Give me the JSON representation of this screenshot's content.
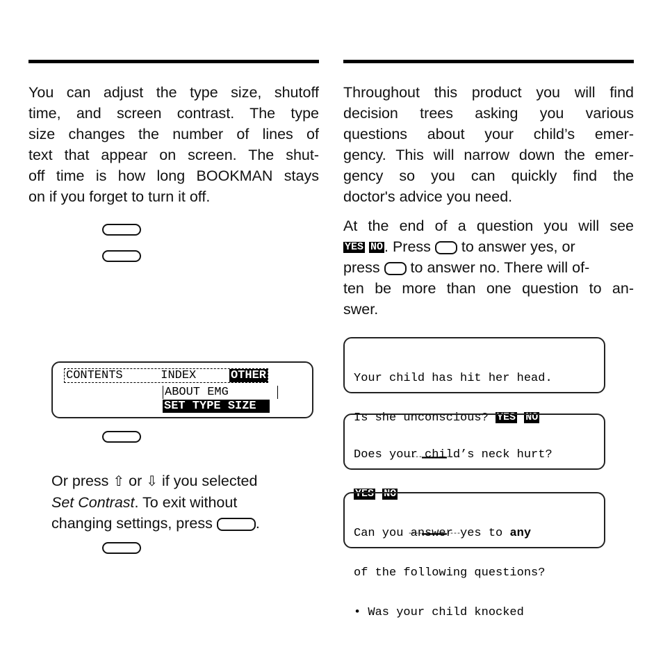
{
  "left": {
    "intro_lines": [
      "You can adjust the type size, shutoff",
      "time, and screen contrast. The type",
      "size changes the number of lines of",
      "text that appear on screen. The shut-",
      "off time is how long BOOKMAN stays",
      "on if you forget to turn it off."
    ],
    "menu_screen": {
      "menu_items": [
        "CONTENTS",
        "INDEX",
        "OTHER"
      ],
      "submenu_items": [
        "ABOUT EMG",
        "SET TYPE SIZE"
      ]
    },
    "or_press": "Or press",
    "or": "or",
    "if_selected": "if you selected",
    "set_contrast": "Set Contrast",
    "exit_text": ". To exit without",
    "changing_text": "changing settings, press",
    "period": ".",
    "up_arrow": "⇧",
    "down_arrow": "⇩"
  },
  "right": {
    "intro_lines": [
      "Throughout this product you will find",
      "decision trees asking you various",
      "questions about your child’s emer-",
      "gency. This will narrow down the emer-",
      "gency so you can quickly find the",
      "doctor's advice you need."
    ],
    "para2_line1": "At the end of a question you will see",
    "yes_tag": "YES",
    "no_tag": "NO",
    "press_text": ". Press",
    "answer_yes": "to answer yes, or",
    "press2": "press",
    "answer_no": "to answer no. There will of-",
    "para2_line4": "ten be more than one question to an-",
    "para2_line5": "swer.",
    "screens": [
      {
        "line1": "Your child has hit her head.",
        "line2": "Is she unconscious?",
        "yes": "YES",
        "no": "NO",
        "scroll": "----▬▬▬▬▬▬▬----"
      },
      {
        "line1": "Does your child’s neck hurt?",
        "yes": "YES",
        "no": "NO",
        "scroll": "----▬▬▬▬▬▬▬----"
      },
      {
        "line1": "Can you answer yes to",
        "line1_bold": "any",
        "line2": "of the following questions?",
        "line3": "• Was your child knocked"
      }
    ]
  }
}
